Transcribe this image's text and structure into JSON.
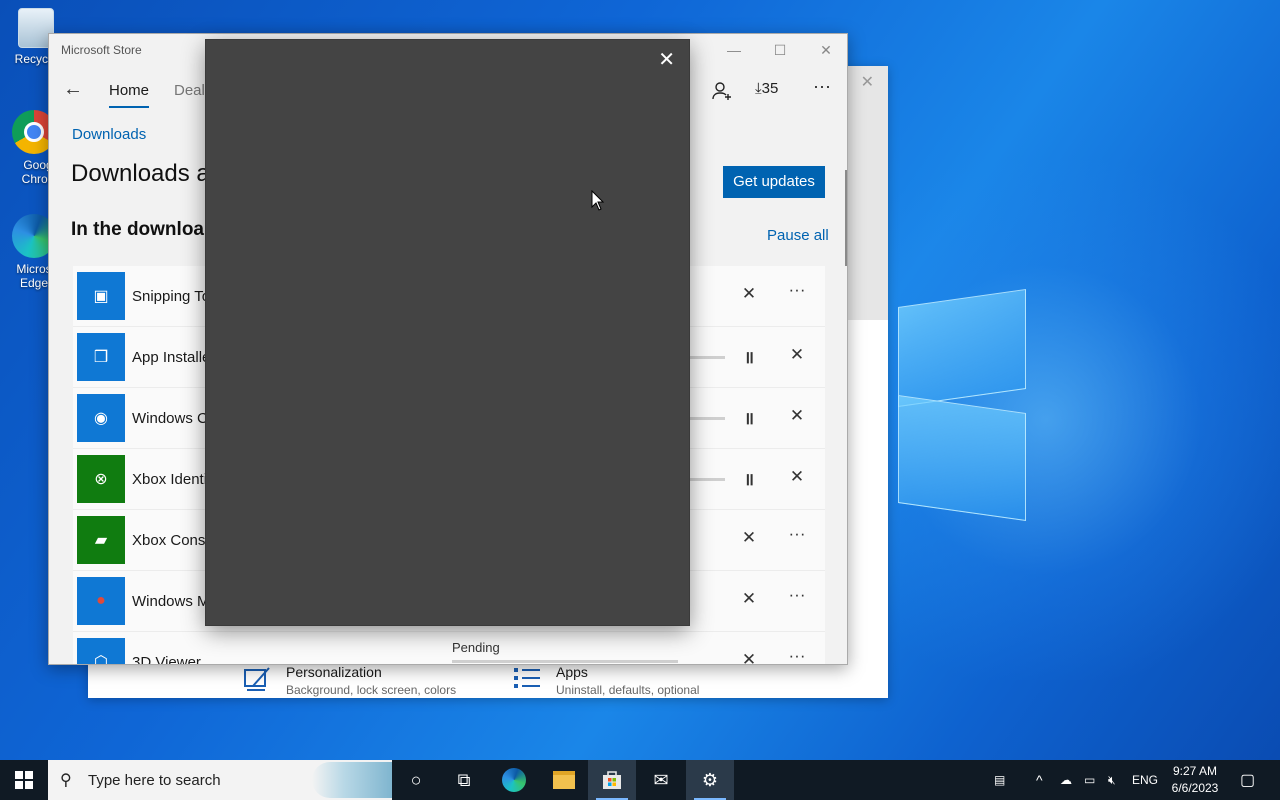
{
  "desktop": {
    "icons": [
      {
        "label": "Recycle"
      },
      {
        "label": "Goog Chron"
      },
      {
        "label": "Micros Edge"
      }
    ]
  },
  "settings_window": {
    "items": [
      {
        "title": "Personalization",
        "subtitle": "Background, lock screen, colors",
        "icon": "personalization-icon"
      },
      {
        "title": "Apps",
        "subtitle": "Uninstall, defaults, optional",
        "icon": "apps-list-icon"
      }
    ]
  },
  "store": {
    "window_title": "Microsoft Store",
    "tabs": [
      "Home",
      "Deals"
    ],
    "downloads_count": "35",
    "breadcrumb": "Downloads",
    "heading": "Downloads a",
    "subheading": "In the downloa",
    "get_updates": "Get updates",
    "pause_all": "Pause all",
    "rows": [
      {
        "name": "Snipping To",
        "color": "#0f78d4",
        "icon": "snipping-icon",
        "state": "queued"
      },
      {
        "name": "App Installe",
        "color": "#0f78d4",
        "icon": "package-icon",
        "state": "downloading"
      },
      {
        "name": "Windows C",
        "color": "#0f78d4",
        "icon": "camera-icon",
        "state": "downloading"
      },
      {
        "name": "Xbox Identi",
        "color": "#107c10",
        "icon": "xbox-icon",
        "state": "downloading"
      },
      {
        "name": "Xbox Conso",
        "color": "#107c10",
        "icon": "xbox-console-icon",
        "state": "queued"
      },
      {
        "name": "Windows M",
        "color": "#0f78d4",
        "icon": "maps-icon",
        "state": "queued"
      },
      {
        "name": "3D Viewer",
        "color": "#0f78d4",
        "icon": "cube-icon",
        "state": "queued"
      }
    ],
    "pending_label": "Pending"
  },
  "taskbar": {
    "search_placeholder": "Type here to search",
    "language": "ENG",
    "time": "9:27 AM",
    "date": "6/6/2023"
  }
}
